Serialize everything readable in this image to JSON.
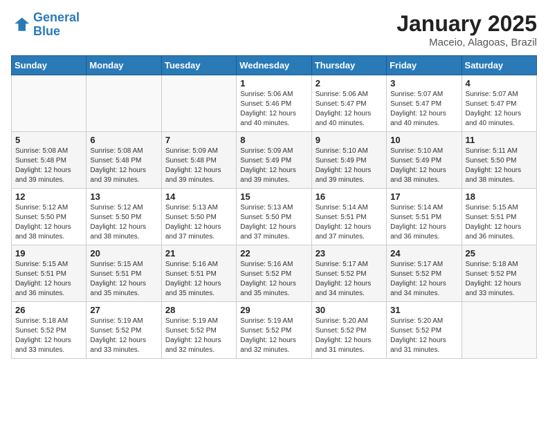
{
  "logo": {
    "line1": "General",
    "line2": "Blue"
  },
  "title": "January 2025",
  "location": "Maceio, Alagoas, Brazil",
  "weekdays": [
    "Sunday",
    "Monday",
    "Tuesday",
    "Wednesday",
    "Thursday",
    "Friday",
    "Saturday"
  ],
  "weeks": [
    [
      {
        "day": "",
        "info": ""
      },
      {
        "day": "",
        "info": ""
      },
      {
        "day": "",
        "info": ""
      },
      {
        "day": "1",
        "info": "Sunrise: 5:06 AM\nSunset: 5:46 PM\nDaylight: 12 hours\nand 40 minutes."
      },
      {
        "day": "2",
        "info": "Sunrise: 5:06 AM\nSunset: 5:47 PM\nDaylight: 12 hours\nand 40 minutes."
      },
      {
        "day": "3",
        "info": "Sunrise: 5:07 AM\nSunset: 5:47 PM\nDaylight: 12 hours\nand 40 minutes."
      },
      {
        "day": "4",
        "info": "Sunrise: 5:07 AM\nSunset: 5:47 PM\nDaylight: 12 hours\nand 40 minutes."
      }
    ],
    [
      {
        "day": "5",
        "info": "Sunrise: 5:08 AM\nSunset: 5:48 PM\nDaylight: 12 hours\nand 39 minutes."
      },
      {
        "day": "6",
        "info": "Sunrise: 5:08 AM\nSunset: 5:48 PM\nDaylight: 12 hours\nand 39 minutes."
      },
      {
        "day": "7",
        "info": "Sunrise: 5:09 AM\nSunset: 5:48 PM\nDaylight: 12 hours\nand 39 minutes."
      },
      {
        "day": "8",
        "info": "Sunrise: 5:09 AM\nSunset: 5:49 PM\nDaylight: 12 hours\nand 39 minutes."
      },
      {
        "day": "9",
        "info": "Sunrise: 5:10 AM\nSunset: 5:49 PM\nDaylight: 12 hours\nand 39 minutes."
      },
      {
        "day": "10",
        "info": "Sunrise: 5:10 AM\nSunset: 5:49 PM\nDaylight: 12 hours\nand 38 minutes."
      },
      {
        "day": "11",
        "info": "Sunrise: 5:11 AM\nSunset: 5:50 PM\nDaylight: 12 hours\nand 38 minutes."
      }
    ],
    [
      {
        "day": "12",
        "info": "Sunrise: 5:12 AM\nSunset: 5:50 PM\nDaylight: 12 hours\nand 38 minutes."
      },
      {
        "day": "13",
        "info": "Sunrise: 5:12 AM\nSunset: 5:50 PM\nDaylight: 12 hours\nand 38 minutes."
      },
      {
        "day": "14",
        "info": "Sunrise: 5:13 AM\nSunset: 5:50 PM\nDaylight: 12 hours\nand 37 minutes."
      },
      {
        "day": "15",
        "info": "Sunrise: 5:13 AM\nSunset: 5:50 PM\nDaylight: 12 hours\nand 37 minutes."
      },
      {
        "day": "16",
        "info": "Sunrise: 5:14 AM\nSunset: 5:51 PM\nDaylight: 12 hours\nand 37 minutes."
      },
      {
        "day": "17",
        "info": "Sunrise: 5:14 AM\nSunset: 5:51 PM\nDaylight: 12 hours\nand 36 minutes."
      },
      {
        "day": "18",
        "info": "Sunrise: 5:15 AM\nSunset: 5:51 PM\nDaylight: 12 hours\nand 36 minutes."
      }
    ],
    [
      {
        "day": "19",
        "info": "Sunrise: 5:15 AM\nSunset: 5:51 PM\nDaylight: 12 hours\nand 36 minutes."
      },
      {
        "day": "20",
        "info": "Sunrise: 5:15 AM\nSunset: 5:51 PM\nDaylight: 12 hours\nand 35 minutes."
      },
      {
        "day": "21",
        "info": "Sunrise: 5:16 AM\nSunset: 5:51 PM\nDaylight: 12 hours\nand 35 minutes."
      },
      {
        "day": "22",
        "info": "Sunrise: 5:16 AM\nSunset: 5:52 PM\nDaylight: 12 hours\nand 35 minutes."
      },
      {
        "day": "23",
        "info": "Sunrise: 5:17 AM\nSunset: 5:52 PM\nDaylight: 12 hours\nand 34 minutes."
      },
      {
        "day": "24",
        "info": "Sunrise: 5:17 AM\nSunset: 5:52 PM\nDaylight: 12 hours\nand 34 minutes."
      },
      {
        "day": "25",
        "info": "Sunrise: 5:18 AM\nSunset: 5:52 PM\nDaylight: 12 hours\nand 33 minutes."
      }
    ],
    [
      {
        "day": "26",
        "info": "Sunrise: 5:18 AM\nSunset: 5:52 PM\nDaylight: 12 hours\nand 33 minutes."
      },
      {
        "day": "27",
        "info": "Sunrise: 5:19 AM\nSunset: 5:52 PM\nDaylight: 12 hours\nand 33 minutes."
      },
      {
        "day": "28",
        "info": "Sunrise: 5:19 AM\nSunset: 5:52 PM\nDaylight: 12 hours\nand 32 minutes."
      },
      {
        "day": "29",
        "info": "Sunrise: 5:19 AM\nSunset: 5:52 PM\nDaylight: 12 hours\nand 32 minutes."
      },
      {
        "day": "30",
        "info": "Sunrise: 5:20 AM\nSunset: 5:52 PM\nDaylight: 12 hours\nand 31 minutes."
      },
      {
        "day": "31",
        "info": "Sunrise: 5:20 AM\nSunset: 5:52 PM\nDaylight: 12 hours\nand 31 minutes."
      },
      {
        "day": "",
        "info": ""
      }
    ]
  ]
}
